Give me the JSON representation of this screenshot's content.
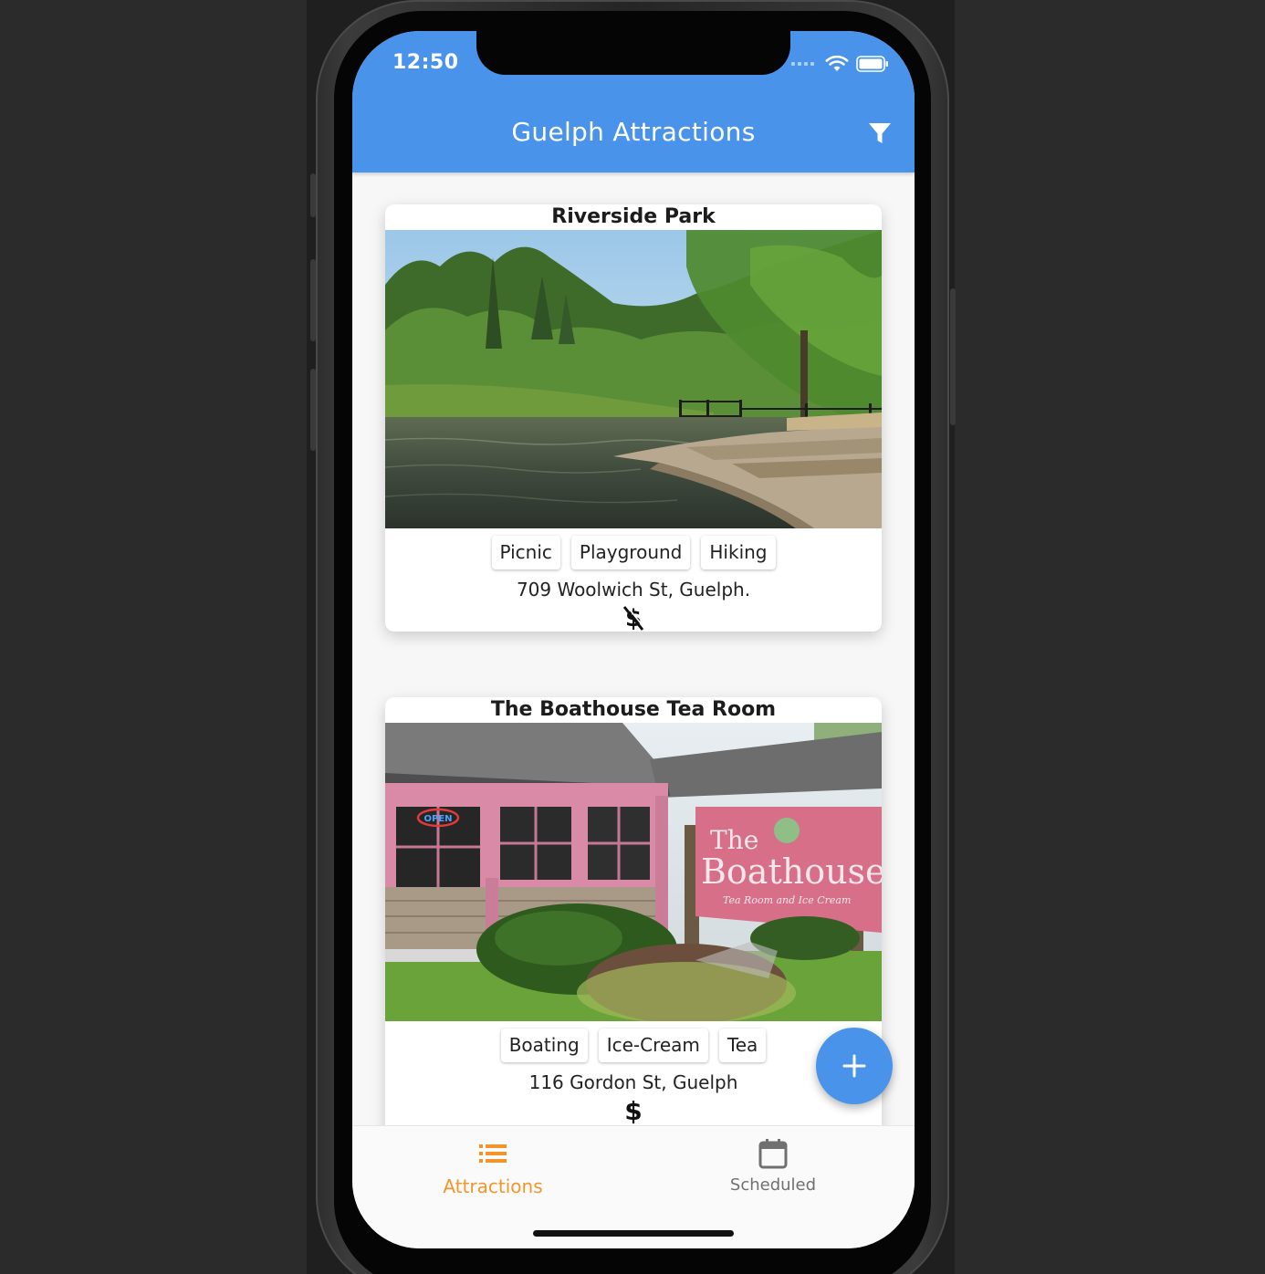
{
  "status_bar": {
    "time": "12:50"
  },
  "app_bar": {
    "title": "Guelph Attractions",
    "filter_icon": "filter-icon"
  },
  "attractions": [
    {
      "name": "Riverside Park",
      "tags": [
        "Picnic",
        "Playground",
        "Hiking"
      ],
      "address": "709 Woolwich St, Guelph.",
      "price_icon": "no-cost-icon"
    },
    {
      "name": "The Boathouse Tea Room",
      "tags": [
        "Boating",
        "Ice-Cream",
        "Tea"
      ],
      "address": "116 Gordon St, Guelph",
      "price_icon": "dollar-icon",
      "sign": {
        "line1": "The",
        "line2": "Boathouse",
        "line3": "Tea Room and Ice Cream",
        "open_sign": "OPEN"
      }
    }
  ],
  "fab": {
    "icon": "plus-icon"
  },
  "bottom_nav": {
    "items": [
      {
        "label": "Attractions",
        "icon": "list-icon",
        "active": true
      },
      {
        "label": "Scheduled",
        "icon": "calendar-icon",
        "active": false
      }
    ]
  },
  "colors": {
    "primary": "#4a93ea",
    "active_nav": "#f2952a",
    "inactive_nav": "#707070",
    "pink_building": "#d98aa6"
  }
}
